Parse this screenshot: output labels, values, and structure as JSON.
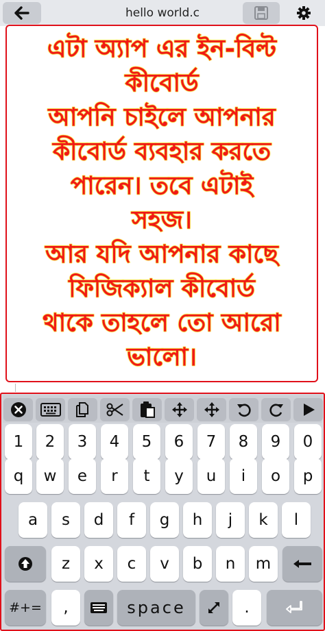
{
  "topbar": {
    "title": "hello world.c",
    "back_icon": "arrow-left-icon",
    "save_icon": "save-icon",
    "settings_icon": "gear-icon"
  },
  "message": {
    "lines": [
      "এটা অ্যাপ এর ইন-বিল্ট",
      "কীবোর্ড",
      "আপনি চাইলে আপনার",
      "কীবোর্ড ব্যবহার করতে",
      "পারেন। তবে এটাই",
      "সহজ।",
      "আর যদি আপনার কাছে",
      "ফিজিক্যাল কীবোর্ড",
      "থাকে তাহলে তো আরো",
      "ভালো।"
    ],
    "text_color": "#f01818",
    "outline_color": "#f0d020",
    "border_color": "#e0101a"
  },
  "keyboard": {
    "toolbar": [
      "close-circle-icon",
      "keyboard-icon",
      "copy-icon",
      "cut-icon",
      "paste-icon",
      "move-icon",
      "move-icon",
      "undo-icon",
      "redo-icon",
      "run-icon"
    ],
    "row_numbers": [
      "1",
      "2",
      "3",
      "4",
      "5",
      "6",
      "7",
      "8",
      "9",
      "0"
    ],
    "row_q": [
      "q",
      "w",
      "e",
      "r",
      "t",
      "y",
      "u",
      "i",
      "o",
      "p"
    ],
    "row_a": [
      "a",
      "s",
      "d",
      "f",
      "g",
      "h",
      "j",
      "k",
      "l"
    ],
    "row_z": [
      "z",
      "x",
      "c",
      "v",
      "b",
      "n",
      "m"
    ],
    "bottom": {
      "symbols": "#+=",
      "comma": ",",
      "space": "space",
      "period": "."
    }
  }
}
